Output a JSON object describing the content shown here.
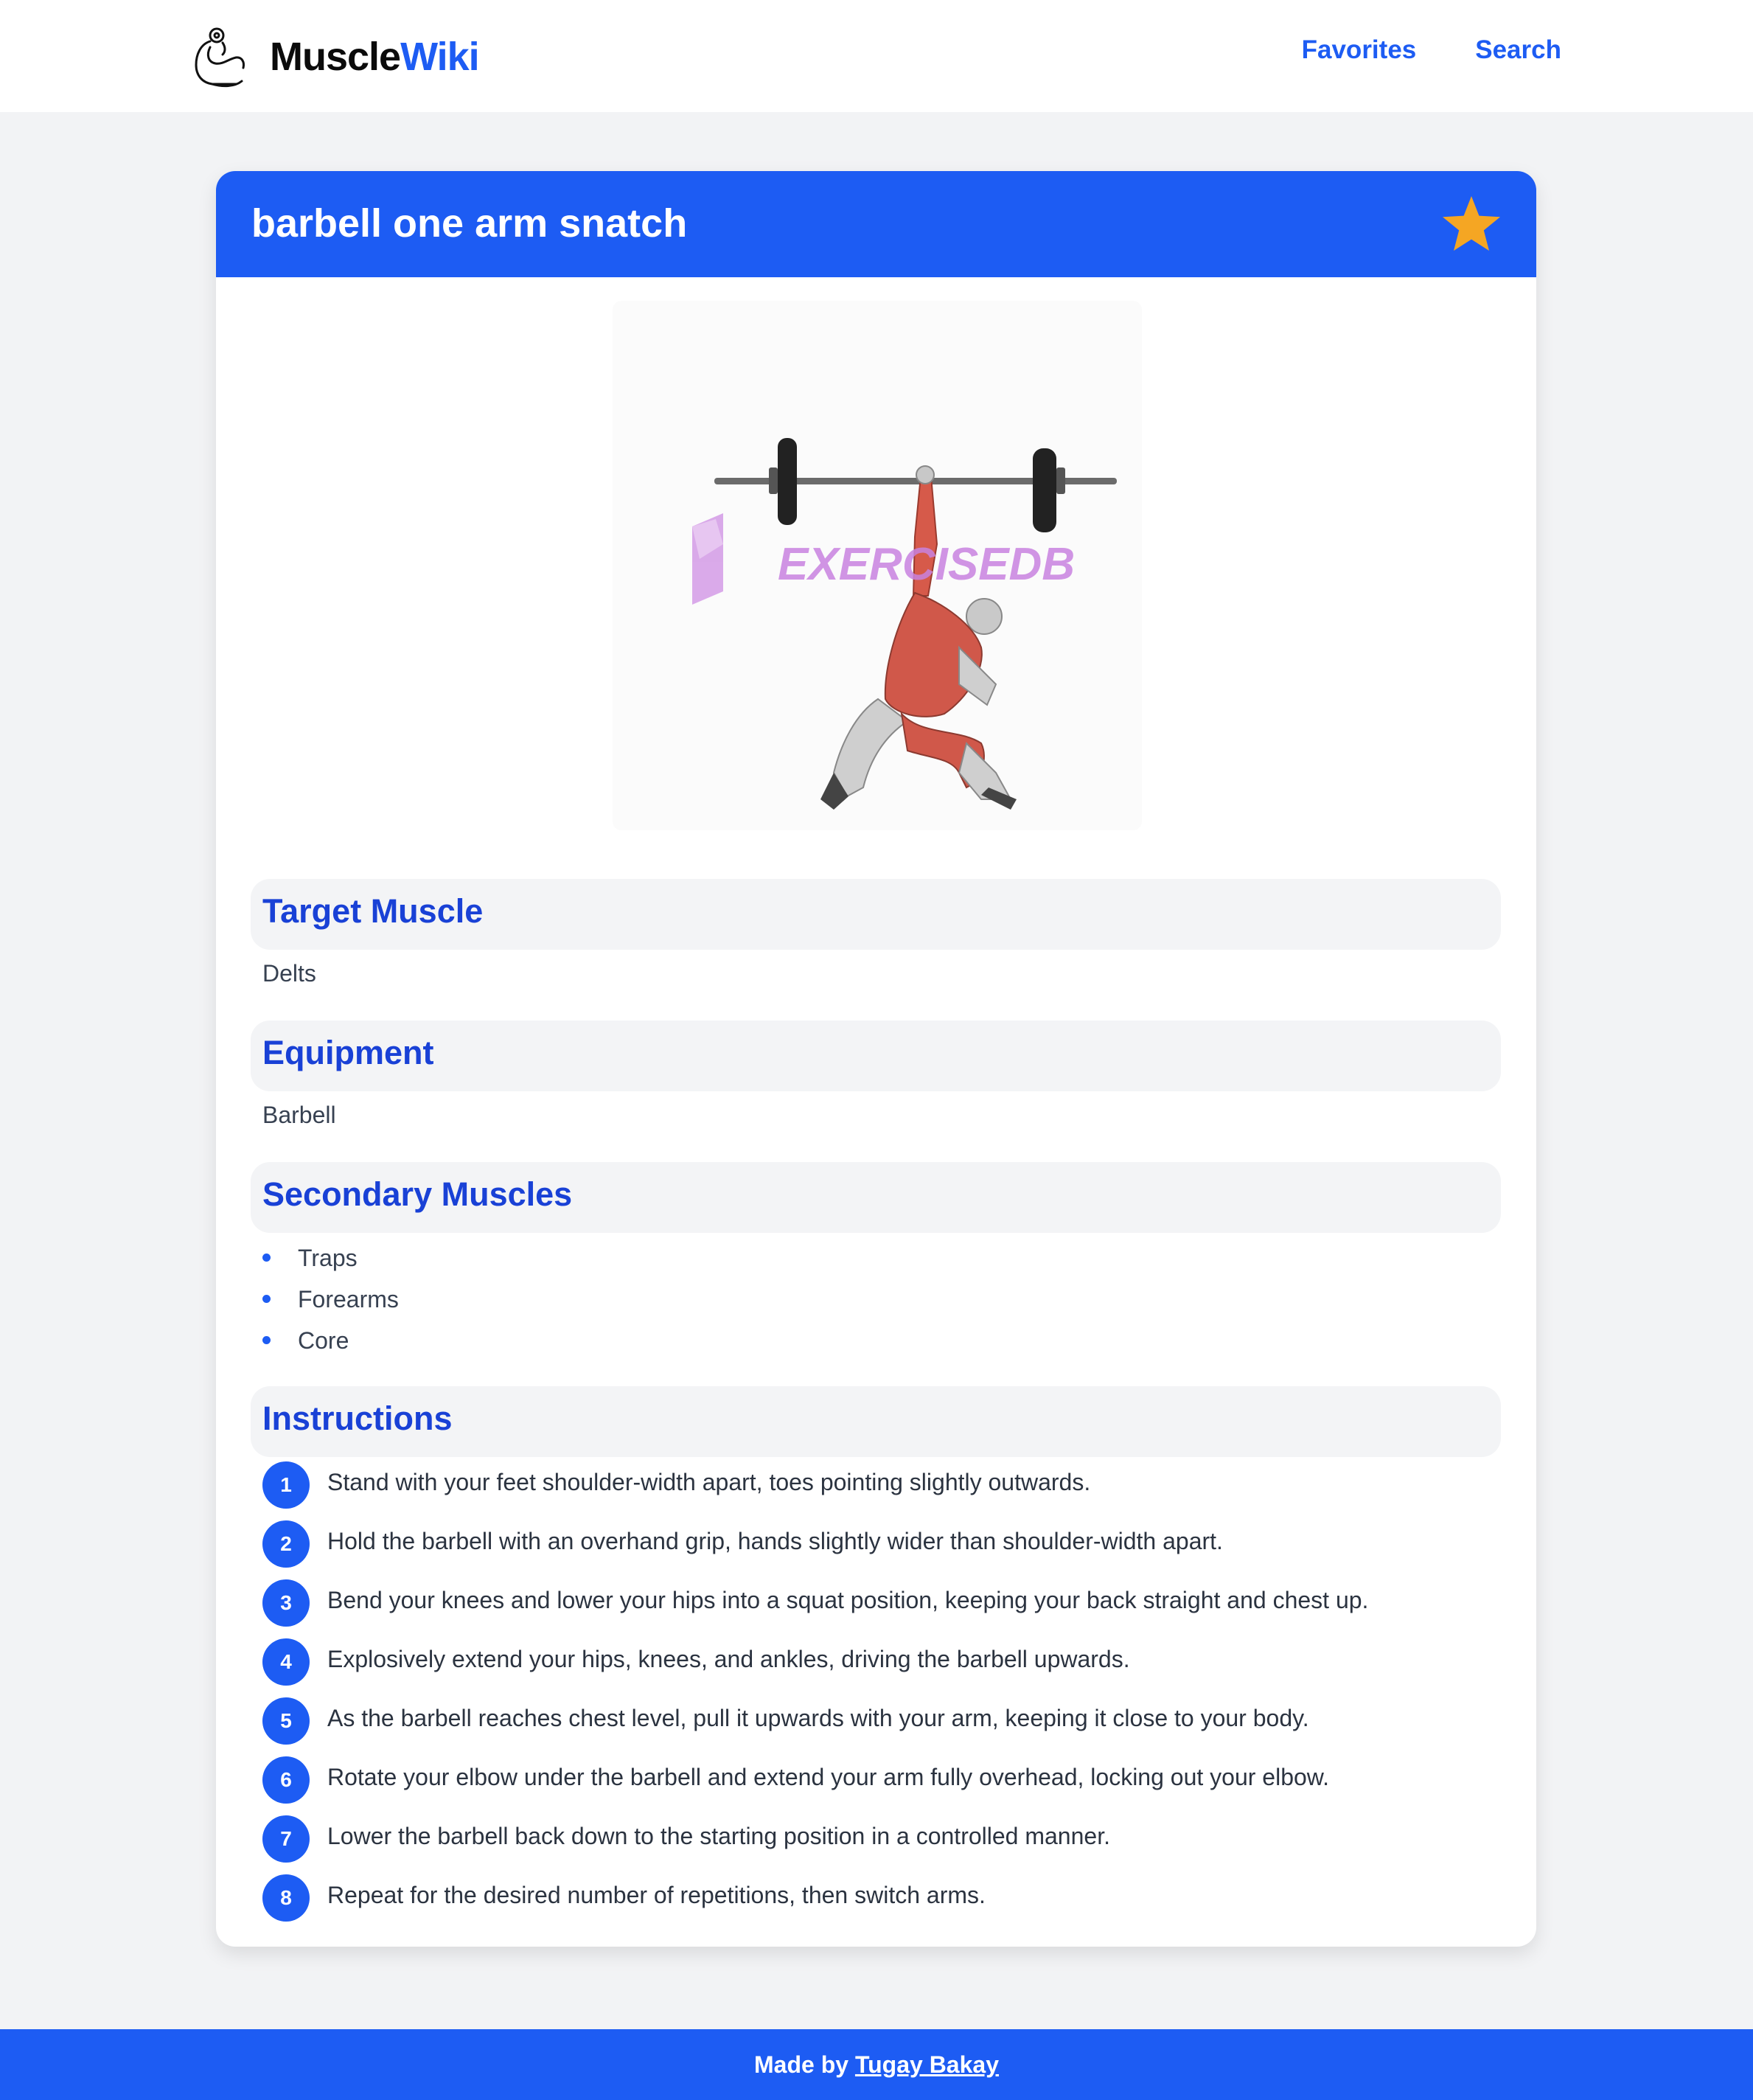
{
  "colors": {
    "accent": "#1d5cf3",
    "heading": "#1941d6",
    "star": "#f5a623",
    "background": "#f2f3f5"
  },
  "header": {
    "brand_part1": "Muscle",
    "brand_part2": "Wiki",
    "logo_icon": "flexed-arm-icon",
    "nav": {
      "favorites": "Favorites",
      "search": "Search"
    }
  },
  "exercise": {
    "title": "barbell one arm snatch",
    "favorite_icon": "star-icon",
    "is_favorite": true,
    "image": {
      "watermark": "EXERCISEDB"
    },
    "target_muscle": {
      "heading": "Target Muscle",
      "value": "Delts"
    },
    "equipment": {
      "heading": "Equipment",
      "value": "Barbell"
    },
    "secondary_muscles": {
      "heading": "Secondary Muscles",
      "items": [
        "Traps",
        "Forearms",
        "Core"
      ]
    },
    "instructions": {
      "heading": "Instructions",
      "steps": [
        {
          "num": "1",
          "text": "Stand with your feet shoulder-width apart, toes pointing slightly outwards."
        },
        {
          "num": "2",
          "text": "Hold the barbell with an overhand grip, hands slightly wider than shoulder-width apart."
        },
        {
          "num": "3",
          "text": "Bend your knees and lower your hips into a squat position, keeping your back straight and chest up."
        },
        {
          "num": "4",
          "text": "Explosively extend your hips, knees, and ankles, driving the barbell upwards."
        },
        {
          "num": "5",
          "text": "As the barbell reaches chest level, pull it upwards with your arm, keeping it close to your body."
        },
        {
          "num": "6",
          "text": "Rotate your elbow under the barbell and extend your arm fully overhead, locking out your elbow."
        },
        {
          "num": "7",
          "text": "Lower the barbell back down to the starting position in a controlled manner."
        },
        {
          "num": "8",
          "text": "Repeat for the desired number of repetitions, then switch arms."
        }
      ]
    }
  },
  "footer": {
    "prefix": "Made by",
    "author": "Tugay Bakay"
  }
}
